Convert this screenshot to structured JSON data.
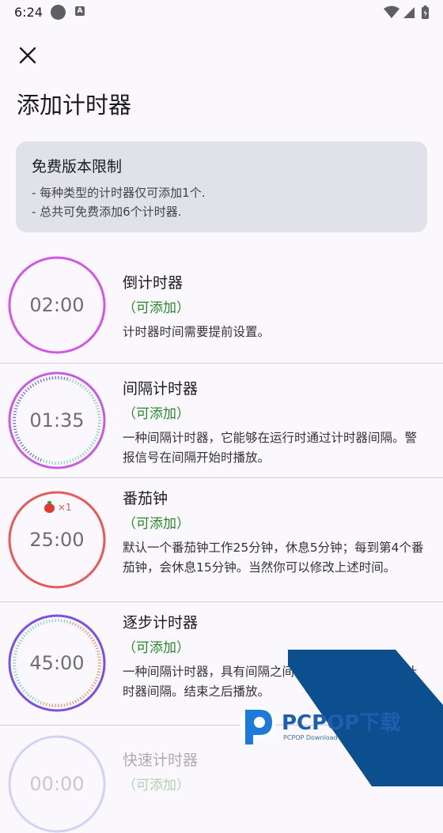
{
  "status_bar": {
    "time": "6:24",
    "notification_icon": "A"
  },
  "header": {
    "title": "添加计时器"
  },
  "limit_card": {
    "title": "免费版本限制",
    "lines": [
      "- 每种类型的计时器仅可添加1个.",
      "- 总共可免费添加6个计时器."
    ]
  },
  "timers": [
    {
      "name": "倒计时器",
      "status": "（可添加）",
      "desc": "计时器时间需要提前设置。",
      "dial": "02:00",
      "ring_color": "#d257e8"
    },
    {
      "name": "间隔计时器",
      "status": "（可添加）",
      "desc": "一种间隔计时器，它能够在运行时通过计时器间隔。警报信号在间隔开始时播放。",
      "dial": "01:35",
      "ring_color": "#c65ddd"
    },
    {
      "name": "番茄钟",
      "status": "（可添加）",
      "desc": "默认一个番茄钟工作25分钟，休息5分钟；每到第4个番茄钟，会休息15分钟。当然你可以修改上述时间。",
      "dial": "25:00",
      "badge": "×1",
      "ring_color": "#e85a5a"
    },
    {
      "name": "逐步计时器",
      "status": "（可添加）",
      "desc": "一种间隔计时器，具有间隔之间它可以在运行时通过计时器间隔。结束之后播放。",
      "dial": "45:00",
      "ring_color": "#7b4fe0"
    },
    {
      "name": "快速计时器",
      "status": "（可添加）",
      "dial": "00:00",
      "ring_color": "#8a8ae8"
    }
  ],
  "watermark": {
    "brand": "PCPOP下载",
    "sub": "PCPOP Download"
  },
  "colors": {
    "status_ok": "#2a8a2a",
    "card_bg": "#e1e1e9",
    "accent": "#0b4f8f"
  }
}
